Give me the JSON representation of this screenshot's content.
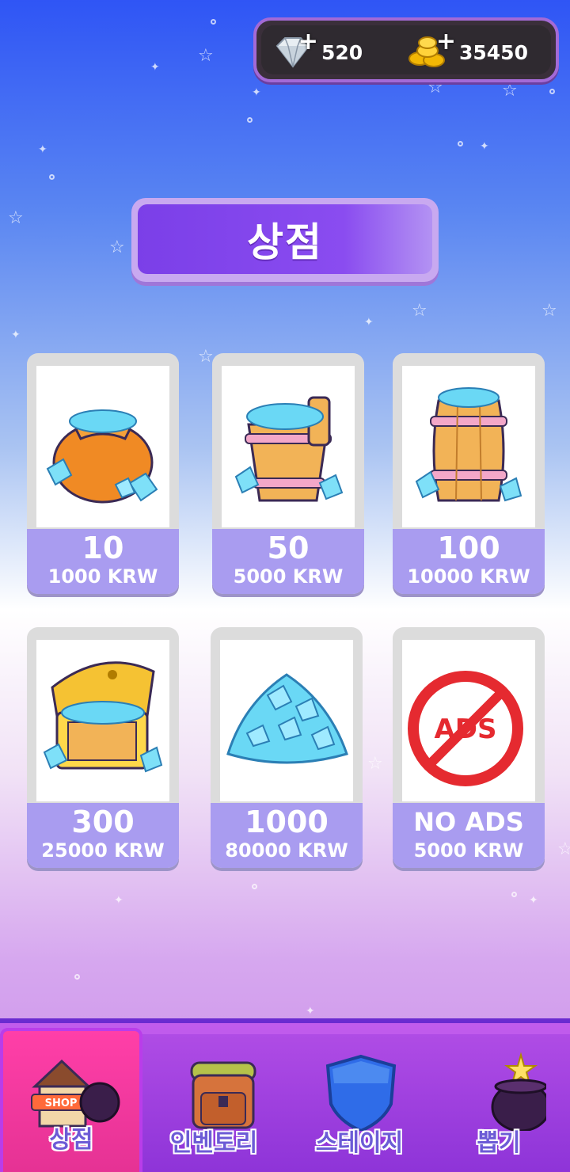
{
  "currency": {
    "gems": "520",
    "coins": "35450",
    "add_symbol": "+"
  },
  "header": {
    "title": "상점"
  },
  "shop": {
    "items": [
      {
        "amount": "10",
        "price": "1000 KRW",
        "icon": "gem-sack-icon"
      },
      {
        "amount": "50",
        "price": "5000 KRW",
        "icon": "gem-bucket-icon"
      },
      {
        "amount": "100",
        "price": "10000 KRW",
        "icon": "gem-barrel-icon"
      },
      {
        "amount": "300",
        "price": "25000 KRW",
        "icon": "gem-chest-icon"
      },
      {
        "amount": "1000",
        "price": "80000 KRW",
        "icon": "gem-pile-icon"
      },
      {
        "amount": "NO ADS",
        "price": "5000 KRW",
        "icon": "no-ads-icon",
        "icon_text": "ADS"
      }
    ]
  },
  "nav": {
    "items": [
      {
        "label": "상점",
        "icon": "shop-icon",
        "active": true,
        "icon_text": "SHOP"
      },
      {
        "label": "인벤토리",
        "icon": "backpack-icon",
        "active": false
      },
      {
        "label": "스테이지",
        "icon": "shield-icon",
        "active": false
      },
      {
        "label": "뽑기",
        "icon": "cauldron-icon",
        "active": false
      }
    ]
  },
  "colors": {
    "accent": "#7b3fe8",
    "card_label": "#a99cf0",
    "nav_active": "#ff3fa8",
    "nav_bg": "#8e34d8"
  }
}
